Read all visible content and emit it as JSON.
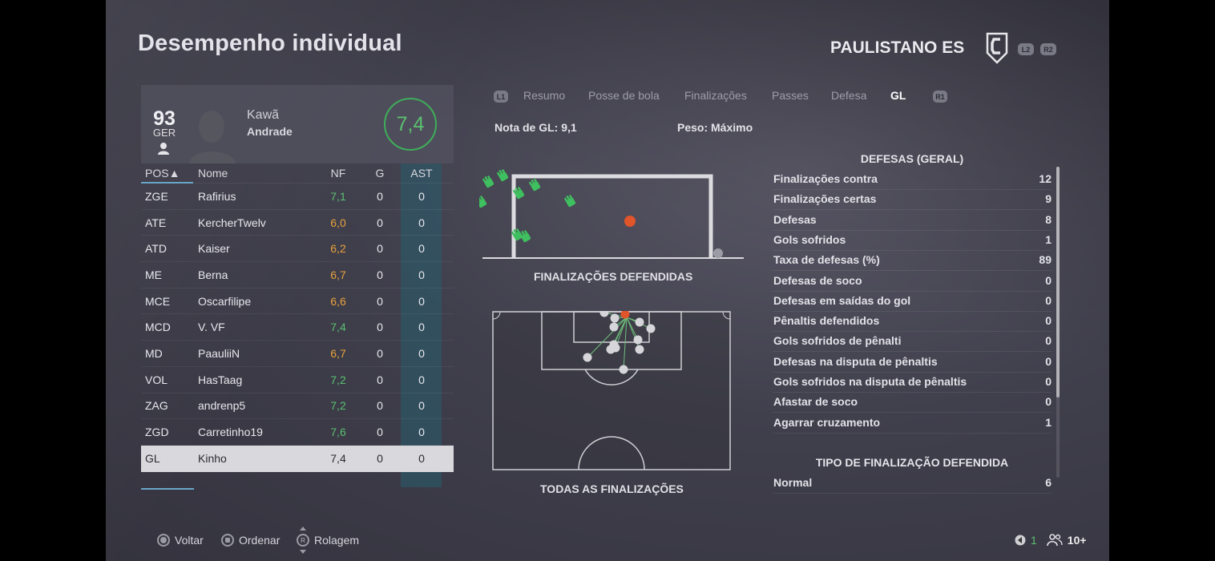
{
  "header": {
    "title": "Desempenho individual",
    "team_name": "PAULISTANO ES",
    "badge_l2": "L2",
    "badge_r2": "R2"
  },
  "player_card": {
    "overall": "93",
    "position": "GER",
    "first_name": "Kawã",
    "last_name": "Andrade",
    "match_rating": "7,4"
  },
  "table": {
    "headers": {
      "pos": "POS▲",
      "name": "Nome",
      "nf": "NF",
      "g": "G",
      "ast": "AST"
    },
    "rows": [
      {
        "pos": "ZGE",
        "name": "Rafirius",
        "nf": "7,1",
        "g": "0",
        "ast": "0",
        "tone": "green"
      },
      {
        "pos": "ATE",
        "name": "KercherTwelv",
        "nf": "6,0",
        "g": "0",
        "ast": "0",
        "tone": "orange"
      },
      {
        "pos": "ATD",
        "name": "Kaiser",
        "nf": "6,2",
        "g": "0",
        "ast": "0",
        "tone": "orange"
      },
      {
        "pos": "ME",
        "name": "Berna",
        "nf": "6,7",
        "g": "0",
        "ast": "0",
        "tone": "orange"
      },
      {
        "pos": "MCE",
        "name": "Oscarfilipe",
        "nf": "6,6",
        "g": "0",
        "ast": "0",
        "tone": "orange"
      },
      {
        "pos": "MCD",
        "name": "V. VF",
        "nf": "7,4",
        "g": "0",
        "ast": "0",
        "tone": "green"
      },
      {
        "pos": "MD",
        "name": "PaauliiN",
        "nf": "6,7",
        "g": "0",
        "ast": "0",
        "tone": "orange"
      },
      {
        "pos": "VOL",
        "name": "HasTaag",
        "nf": "7,2",
        "g": "0",
        "ast": "0",
        "tone": "green"
      },
      {
        "pos": "ZAG",
        "name": "andrenp5",
        "nf": "7,2",
        "g": "0",
        "ast": "0",
        "tone": "green"
      },
      {
        "pos": "ZGD",
        "name": "Carretinho19",
        "nf": "7,6",
        "g": "0",
        "ast": "0",
        "tone": "green"
      },
      {
        "pos": "GL",
        "name": "Kinho",
        "nf": "7,4",
        "g": "0",
        "ast": "0",
        "tone": "selected"
      }
    ]
  },
  "tabs": {
    "l1": "L1",
    "r1": "R1",
    "items": [
      "Resumo",
      "Posse de bola",
      "Finalizações",
      "Passes",
      "Defesa",
      "GL"
    ],
    "active": "GL"
  },
  "summary": {
    "gk_rating": "Nota de GL: 9,1",
    "weight": "Peso: Máximo"
  },
  "captions": {
    "goal": "FINALIZAÇÕES DEFENDIDAS",
    "pitch": "TODAS AS FINALIZAÇÕES"
  },
  "stats": {
    "title": "DEFESAS (GERAL)",
    "items": [
      {
        "label": "Finalizações contra",
        "value": "12"
      },
      {
        "label": "Finalizações certas",
        "value": "9"
      },
      {
        "label": "Defesas",
        "value": "8"
      },
      {
        "label": "Gols sofridos",
        "value": "1"
      },
      {
        "label": "Taxa de defesas (%)",
        "value": "89"
      },
      {
        "label": "Defesas de soco",
        "value": "0"
      },
      {
        "label": "Defesas em saídas do gol",
        "value": "0"
      },
      {
        "label": "Pênaltis defendidos",
        "value": "0"
      },
      {
        "label": "Gols sofridos de pênalti",
        "value": "0"
      },
      {
        "label": "Defesas na disputa de pênaltis",
        "value": "0"
      },
      {
        "label": "Gols sofridos na disputa de pênaltis",
        "value": "0"
      },
      {
        "label": "Afastar de soco",
        "value": "0"
      },
      {
        "label": "Agarrar cruzamento",
        "value": "1"
      }
    ],
    "type_title": "TIPO DE FINALIZAÇÃO DEFENDIDA",
    "type_items": [
      {
        "label": "Normal",
        "value": "6"
      }
    ]
  },
  "footer": {
    "back": "Voltar",
    "sort": "Ordenar",
    "scroll": "Rolagem",
    "r_glyph": "R",
    "count_a": "1",
    "count_b": "10+"
  },
  "colors": {
    "save": "#3fbf5f",
    "goal": "#e0552a",
    "shot": "#d6d6da",
    "rating_green": "#5bc070",
    "rating_orange": "#e8a23c",
    "highlight_row": "#d9d8dd"
  },
  "icons": [
    "club-crest-icon",
    "person-icon",
    "glove-icon",
    "ball-icon",
    "circle-button-icon",
    "square-button-icon",
    "stick-icon",
    "mic-icon",
    "players-icon"
  ]
}
